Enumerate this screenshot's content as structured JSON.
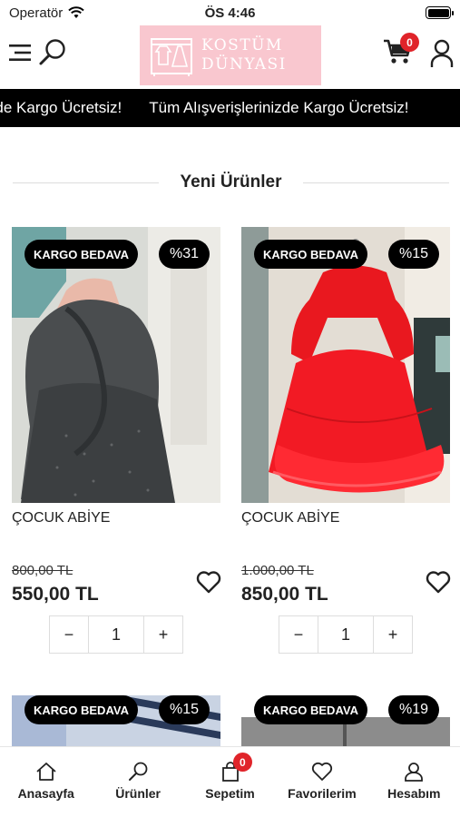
{
  "status_bar": {
    "carrier": "Operatör",
    "time": "ÖS 4:46"
  },
  "header": {
    "logo_line1": "KOSTÜM",
    "logo_line2": "DÜNYASI",
    "cart_count": "0"
  },
  "marquee": {
    "text_partial": "lerinizde Kargo Ücretsiz!",
    "text_full": "Tüm Alışverişlerinizde Kargo Ücretsiz!"
  },
  "section": {
    "title": "Yeni Ürünler"
  },
  "products": [
    {
      "badge": "KARGO BEDAVA",
      "discount": "%31",
      "name": "ÇOCUK ABİYE",
      "old_price": "800,00 TL",
      "price": "550,00 TL",
      "quantity": "1"
    },
    {
      "badge": "KARGO BEDAVA",
      "discount": "%15",
      "name": "ÇOCUK ABİYE",
      "old_price": "1.000,00 TL",
      "price": "850,00 TL",
      "quantity": "1"
    },
    {
      "badge": "KARGO BEDAVA",
      "discount": "%15"
    },
    {
      "badge": "KARGO BEDAVA",
      "discount": "%19"
    }
  ],
  "stepper": {
    "minus": "−",
    "plus": "+"
  },
  "tabbar": {
    "items": [
      {
        "label": "Anasayfa"
      },
      {
        "label": "Ürünler"
      },
      {
        "label": "Sepetim",
        "badge": "0"
      },
      {
        "label": "Favorilerim"
      },
      {
        "label": "Hesabım"
      }
    ]
  }
}
